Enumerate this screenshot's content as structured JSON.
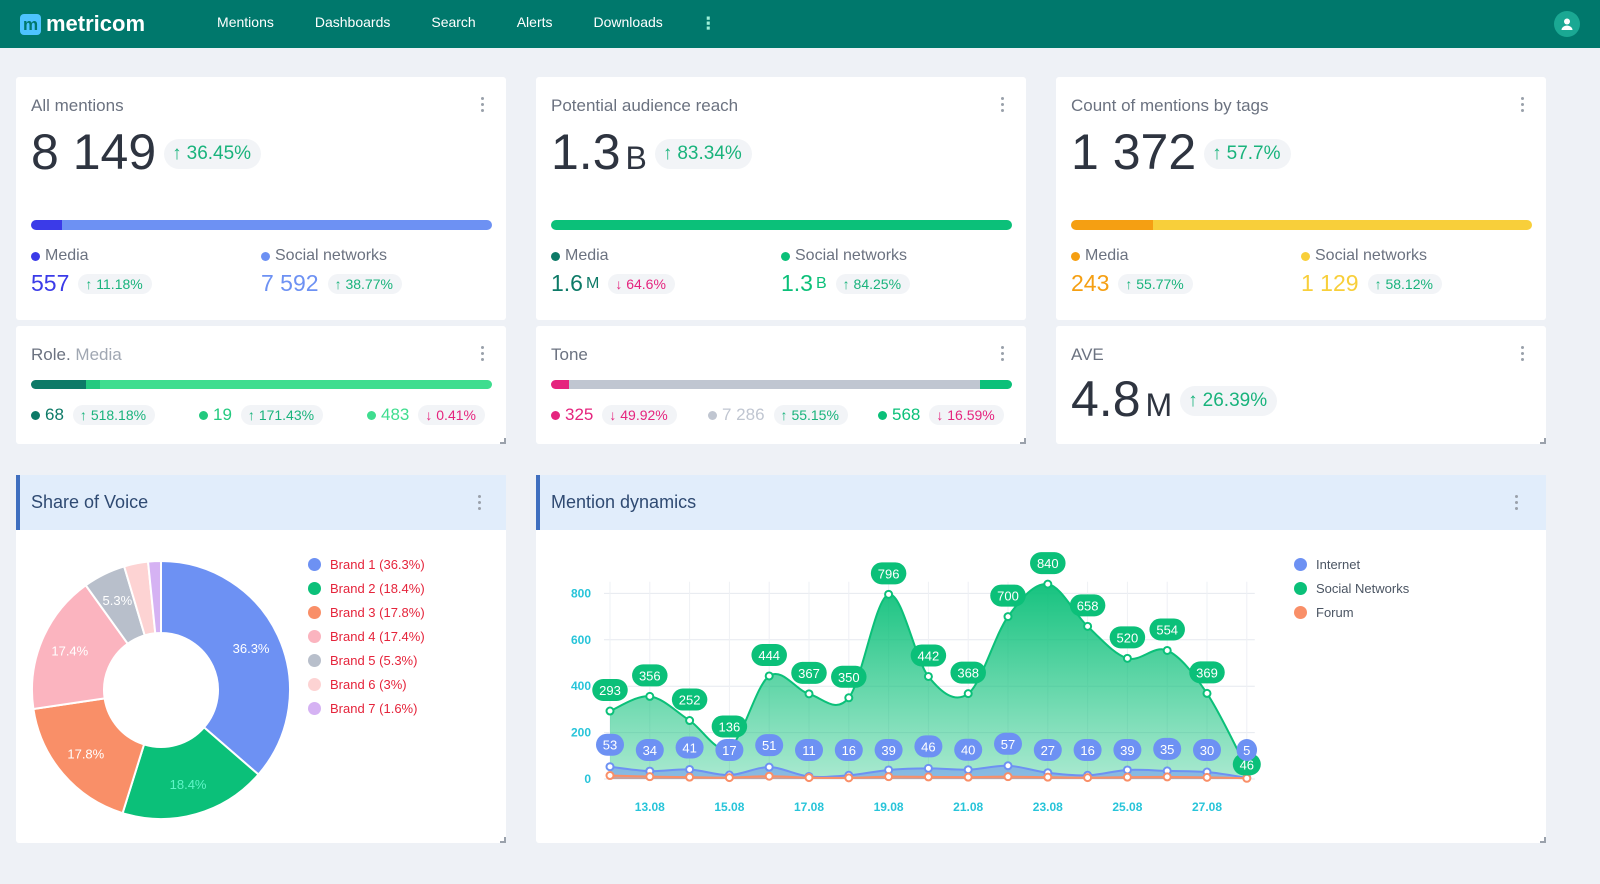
{
  "app": {
    "logo_letter": "m",
    "name": "metricom"
  },
  "nav": [
    "Mentions",
    "Dashboards",
    "Search",
    "Alerts",
    "Downloads"
  ],
  "colors": {
    "brand": "#00786c",
    "up": "#19b37c",
    "down": "#e5247e"
  },
  "cards": {
    "all_mentions": {
      "title": "All mentions",
      "value": "8 149",
      "change": "36.45%",
      "bar": [
        {
          "color": "#3b3be8",
          "fraction": 0.068
        },
        {
          "color": "#6d91f3",
          "fraction": 0.932
        }
      ],
      "media": {
        "label": "Media",
        "value": "557",
        "change": "11.18%",
        "dir": "up",
        "color": "#3b3be8"
      },
      "social": {
        "label": "Social networks",
        "value": "7 592",
        "change": "38.77%",
        "dir": "up",
        "color": "#6d91f3"
      }
    },
    "audience": {
      "title": "Potential audience reach",
      "value": "1.3",
      "unit": "B",
      "change": "83.34%",
      "bar": [
        {
          "color": "#0bc079",
          "fraction": 1.0
        }
      ],
      "media": {
        "label": "Media",
        "value": "1.6",
        "unit": "M",
        "change": "64.6%",
        "dir": "down",
        "color": "#0d7a67"
      },
      "social": {
        "label": "Social networks",
        "value": "1.3",
        "unit": "B",
        "change": "84.25%",
        "dir": "up",
        "color": "#0bc079"
      }
    },
    "tags": {
      "title": "Count of mentions by tags",
      "value": "1 372",
      "change": "57.7%",
      "bar": [
        {
          "color": "#f59f12",
          "fraction": 0.177
        },
        {
          "color": "#f8cf3a",
          "fraction": 0.823
        }
      ],
      "media": {
        "label": "Media",
        "value": "243",
        "change": "55.77%",
        "dir": "up",
        "color": "#f59f12"
      },
      "social": {
        "label": "Social networks",
        "value": "1 129",
        "change": "58.12%",
        "dir": "up",
        "color": "#f8cf3a"
      }
    },
    "role": {
      "title": "Role.",
      "subtitle": "Media",
      "bar": [
        {
          "color": "#0d7a67",
          "fraction": 0.12
        },
        {
          "color": "#23c97f",
          "fraction": 0.03
        },
        {
          "color": "#3fdd8f",
          "fraction": 0.85
        }
      ],
      "stats": [
        {
          "value": "68",
          "change": "518.18%",
          "dir": "up",
          "color": "#0d7a67"
        },
        {
          "value": "19",
          "change": "171.43%",
          "dir": "up",
          "color": "#23c97f"
        },
        {
          "value": "483",
          "change": "0.41%",
          "dir": "down",
          "color": "#3fdd8f"
        }
      ]
    },
    "tone": {
      "title": "Tone",
      "bar": [
        {
          "color": "#e5247e",
          "fraction": 0.04
        },
        {
          "color": "#c0c6d1",
          "fraction": 0.89
        },
        {
          "color": "#0bc079",
          "fraction": 0.07
        }
      ],
      "stats": [
        {
          "value": "325",
          "change": "49.92%",
          "dir": "down",
          "color": "#e5247e"
        },
        {
          "value": "7 286",
          "change": "55.15%",
          "dir": "up",
          "color": "#c0c6d1"
        },
        {
          "value": "568",
          "change": "16.59%",
          "dir": "down",
          "color": "#0bc079"
        }
      ]
    },
    "ave": {
      "title": "AVE",
      "value": "4.8",
      "unit": "M",
      "change": "26.39%"
    }
  },
  "sov": {
    "title": "Share of Voice",
    "chart_data": {
      "type": "pie",
      "categories": [
        "Brand 1",
        "Brand 2",
        "Brand 3",
        "Brand 4",
        "Brand 5",
        "Brand 6",
        "Brand 7"
      ],
      "values": [
        36.3,
        18.4,
        17.8,
        17.4,
        5.3,
        3.0,
        1.6
      ],
      "legend": [
        "Brand 1 (36.3%)",
        "Brand 2 (18.4%)",
        "Brand 3 (17.8%)",
        "Brand 4 (17.4%)",
        "Brand 5 (5.3%)",
        "Brand 6 (3%)",
        "Brand 7 (1.6%)"
      ],
      "slice_labels": [
        "36.3%",
        "18.4%",
        "17.8%",
        "17.4%",
        "5.3%",
        "",
        ""
      ],
      "colors": [
        "#6d91f3",
        "#0bc079",
        "#f98f68",
        "#fbb4bf",
        "#b8bfcb",
        "#fdd3d3",
        "#d5b2f3"
      ],
      "legend_position": "right"
    }
  },
  "dynamics": {
    "title": "Mention dynamics",
    "chart_data": {
      "type": "area",
      "x": [
        "12.08",
        "13.08",
        "14.08",
        "15.08",
        "16.08",
        "17.08",
        "18.08",
        "19.08",
        "20.08",
        "21.08",
        "22.08",
        "23.08",
        "24.08",
        "25.08",
        "26.08",
        "27.08",
        "28.08"
      ],
      "x_tick_labels": [
        "13.08",
        "15.08",
        "17.08",
        "19.08",
        "21.08",
        "23.08",
        "25.08",
        "27.08"
      ],
      "y_ticks": [
        "0",
        "200",
        "400",
        "600",
        "800"
      ],
      "ylim": [
        0,
        900
      ],
      "legend_position": "right",
      "series": [
        {
          "name": "Internet",
          "color": "#6d91f3",
          "values": [
            53,
            34,
            41,
            17,
            51,
            11,
            16,
            39,
            46,
            40,
            57,
            27,
            16,
            39,
            35,
            30,
            5
          ]
        },
        {
          "name": "Social Networks",
          "color": "#0bc079",
          "values": [
            293,
            356,
            252,
            136,
            444,
            367,
            350,
            796,
            442,
            368,
            700,
            840,
            658,
            520,
            554,
            369,
            46
          ]
        },
        {
          "name": "Forum",
          "color": "#f98f68",
          "values": [
            15,
            10,
            8,
            6,
            12,
            6,
            5,
            10,
            9,
            8,
            10,
            8,
            6,
            8,
            9,
            7,
            3
          ]
        }
      ],
      "data_labels": {
        "Social Networks": [
          "293",
          "356",
          "252",
          "136",
          "444",
          "367",
          "350",
          "796",
          "442",
          "368",
          "700",
          "840",
          "658",
          "520",
          "554",
          "369",
          "46"
        ],
        "Internet": [
          "53",
          "34",
          "41",
          "17",
          "51",
          "11",
          "16",
          "39",
          "46",
          "40",
          "57",
          "27",
          "16",
          "39",
          "35",
          "30",
          "5"
        ]
      }
    }
  }
}
